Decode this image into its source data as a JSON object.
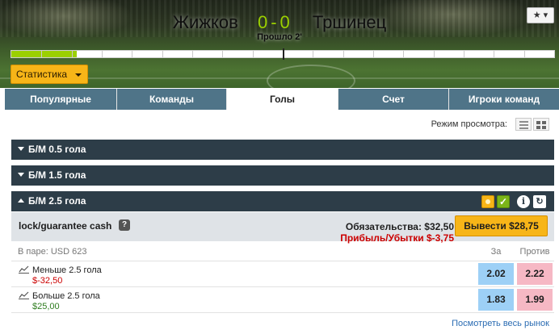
{
  "event": {
    "home_team": "Жижков",
    "away_team": "Тршинец",
    "score": "0-0",
    "elapsed": "Прошло 2'",
    "favourite_icon": "star-icon",
    "progress_fraction": 0.02
  },
  "stats_button": {
    "label": "Статистика"
  },
  "tabs": [
    {
      "label": "Популярные"
    },
    {
      "label": "Команды"
    },
    {
      "label": "Голы"
    },
    {
      "label": "Счет"
    },
    {
      "label": "Игроки команд"
    }
  ],
  "active_tab": "Голы",
  "view_mode": {
    "label": "Режим просмотра:"
  },
  "markets": [
    {
      "name": "Б/М 0.5 гола",
      "expanded": false
    },
    {
      "name": "Б/М 1.5 гола",
      "expanded": false
    },
    {
      "name": "Б/М 2.5 гола",
      "expanded": true
    }
  ],
  "cashout": {
    "title": "lock/guarantee cash",
    "liability": "Обязательства: $32,50",
    "profit_loss": "Прибыль/Убытки $-3,75",
    "button_label": "Вывести $28,75"
  },
  "matched": {
    "label": "В паре: USD 623",
    "back_header": "За",
    "lay_header": "Против"
  },
  "selections": [
    {
      "name": "Меньше 2.5 гола",
      "pnl": "$-32,50",
      "pnl_color": "#cc0000",
      "back": "2.02",
      "lay": "2.22"
    },
    {
      "name": "Больше 2.5 гола",
      "pnl": "$25,00",
      "pnl_color": "#2e7d1f",
      "back": "1.83",
      "lay": "1.99"
    }
  ],
  "full_market_link": "Посмотреть весь рынок",
  "colors": {
    "accent_orange": "#f7b518",
    "market_bar": "#2d3d48",
    "tab_bg": "#4f7488",
    "back_blue": "#9dd0f6",
    "lay_pink": "#f6b8c4",
    "score_green": "#9bd000"
  }
}
